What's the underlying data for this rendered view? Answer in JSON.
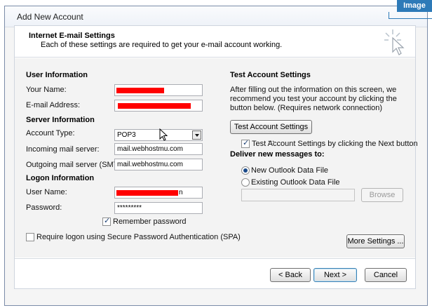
{
  "badge": "Image",
  "window": {
    "title": "Add New Account"
  },
  "header": {
    "title": "Internet E-mail Settings",
    "subtitle": "Each of these settings are required to get your e-mail account working."
  },
  "user_info": {
    "heading": "User Information",
    "your_name_label": "Your Name:",
    "email_label": "E-mail Address:"
  },
  "server_info": {
    "heading": "Server Information",
    "account_type_label": "Account Type:",
    "account_type_value": "POP3",
    "incoming_label": "Incoming mail server:",
    "incoming_value": "mail.webhostmu.com",
    "outgoing_label": "Outgoing mail server (SMTP):",
    "outgoing_value": "mail.webhostmu.com"
  },
  "logon_info": {
    "heading": "Logon Information",
    "username_label": "User Name:",
    "username_suffix": "n",
    "password_label": "Password:",
    "password_value": "*********",
    "remember_label": "Remember password",
    "spa_label": "Require logon using Secure Password Authentication (SPA)"
  },
  "test_settings": {
    "heading": "Test Account Settings",
    "description": "After filling out the information on this screen, we recommend you test your account by clicking the button below. (Requires network connection)",
    "button": "Test Account Settings ...",
    "checkbox_label": "Test Account Settings by clicking the Next button"
  },
  "deliver": {
    "heading": "Deliver new messages to:",
    "new_file_label": "New Outlook Data File",
    "existing_file_label": "Existing Outlook Data File",
    "browse_button": "Browse"
  },
  "buttons": {
    "more_settings": "More Settings ...",
    "back": "< Back",
    "next": "Next >",
    "cancel": "Cancel"
  }
}
